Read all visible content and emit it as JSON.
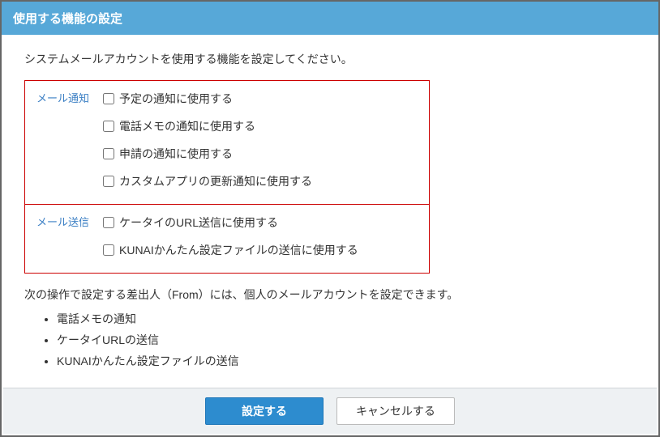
{
  "header": {
    "title": "使用する機能の設定"
  },
  "intro": "システムメールアカウントを使用する機能を設定してください。",
  "sections": {
    "notify": {
      "label": "メール通知",
      "opts": [
        "予定の通知に使用する",
        "電話メモの通知に使用する",
        "申請の通知に使用する",
        "カスタムアプリの更新通知に使用する"
      ]
    },
    "send": {
      "label": "メール送信",
      "opts": [
        "ケータイのURL送信に使用する",
        "KUNAIかんたん設定ファイルの送信に使用する"
      ]
    }
  },
  "note": {
    "text": "次の操作で設定する差出人（From）には、個人のメールアカウントを設定できます。",
    "items": [
      "電話メモの通知",
      "ケータイURLの送信",
      "KUNAIかんたん設定ファイルの送信"
    ]
  },
  "buttons": {
    "submit": "設定する",
    "cancel": "キャンセルする"
  }
}
